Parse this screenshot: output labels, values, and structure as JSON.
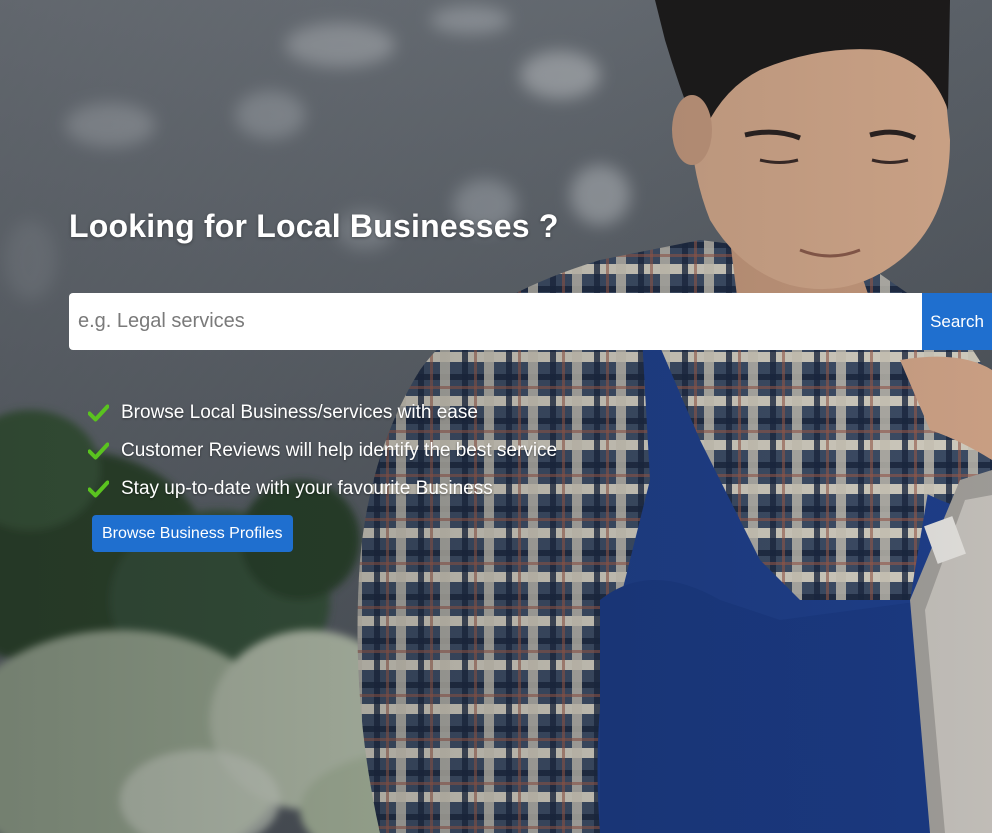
{
  "hero": {
    "headline": "Looking for Local Businesses ?",
    "background_image": "man-in-apron-with-tablet-at-produce-market"
  },
  "search": {
    "placeholder": "e.g. Legal services",
    "value": "",
    "button_label": "Search"
  },
  "features": {
    "icon": "check-icon",
    "items": [
      {
        "label": "Browse Local Business/services with ease"
      },
      {
        "label": "Customer Reviews will help identify the best service"
      },
      {
        "label": "Stay up-to-date with your favourite Business"
      }
    ]
  },
  "cta": {
    "browse_label": "Browse Business Profiles"
  },
  "colors": {
    "accent_blue": "#1f6fcf",
    "check_green": "#5ac31f",
    "text_white": "#ffffff"
  }
}
